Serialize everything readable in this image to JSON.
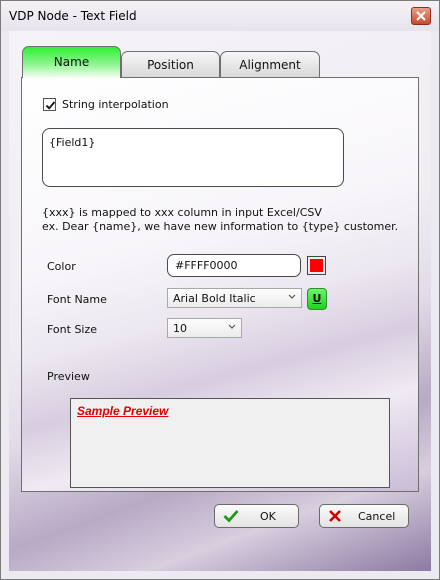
{
  "window": {
    "title": "VDP Node - Text Field"
  },
  "tabs": [
    {
      "label": "Name",
      "active": true
    },
    {
      "label": "Position",
      "active": false
    },
    {
      "label": "Alignment",
      "active": false
    }
  ],
  "string_interpolation": {
    "label": "String interpolation",
    "checked": true
  },
  "text_value": "{Field1}",
  "help": {
    "line1": "{xxx} is mapped to xxx column in input Excel/CSV",
    "line2": "ex. Dear {name}, we have new information to {type} customer."
  },
  "color": {
    "label": "Color",
    "value": "#FFFF0000",
    "swatch": "#ff0000"
  },
  "font_name": {
    "label": "Font Name",
    "value": "Arial Bold Italic",
    "underline_button": "U"
  },
  "font_size": {
    "label": "Font Size",
    "value": "10"
  },
  "preview": {
    "label": "Preview",
    "text": "Sample Preview"
  },
  "buttons": {
    "ok": "OK",
    "cancel": "Cancel"
  },
  "colors": {
    "active_tab": "#2ef033",
    "preview_text": "#e00000",
    "close_button": "#c94a2c"
  }
}
